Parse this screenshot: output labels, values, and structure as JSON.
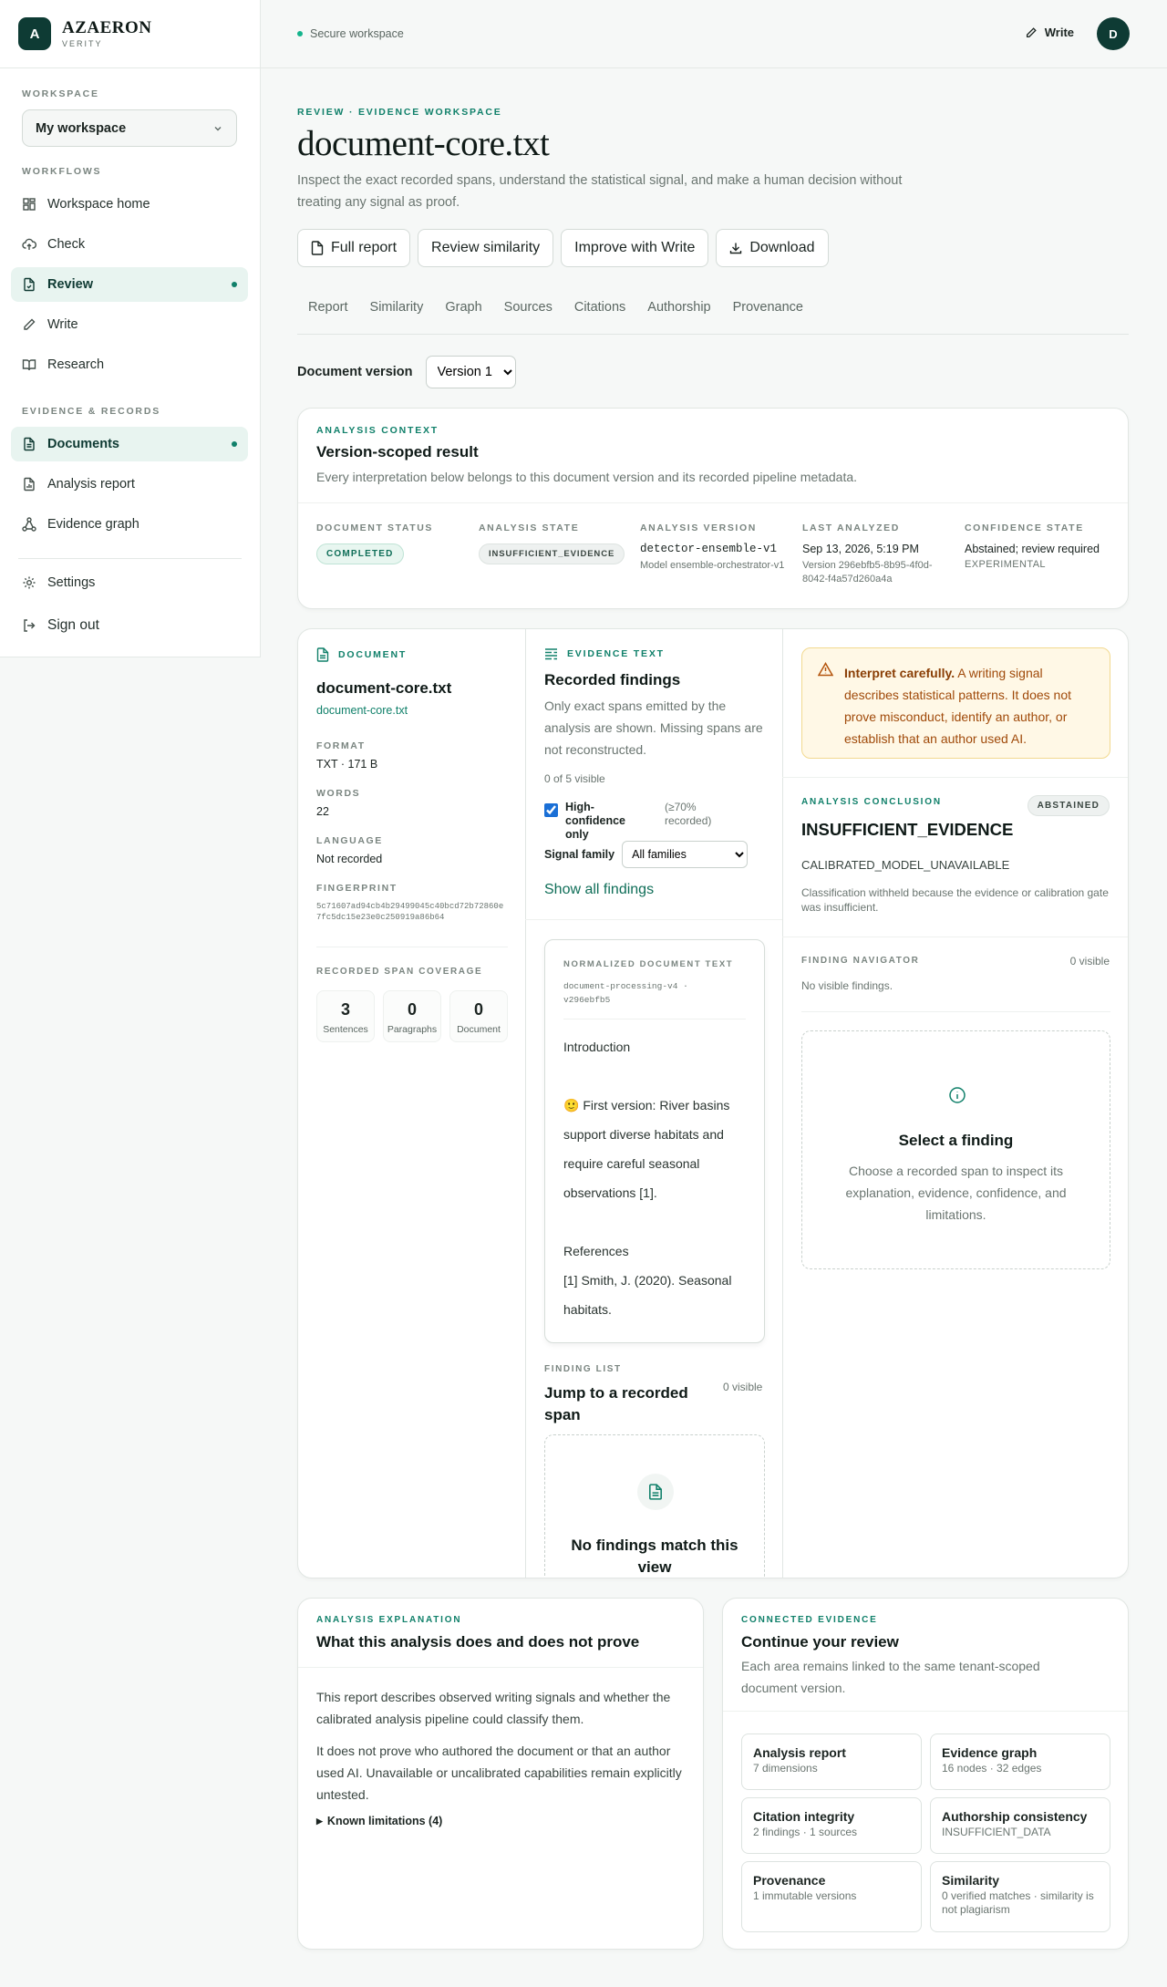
{
  "brand": {
    "logo": "A",
    "name": "AZAERON",
    "sub": "VERITY"
  },
  "sidebar": {
    "workspace_label": "WORKSPACE",
    "workspace_value": "My workspace",
    "workflows_label": "WORKFLOWS",
    "workflows": [
      {
        "label": "Workspace home",
        "icon": "grid-icon"
      },
      {
        "label": "Check",
        "icon": "cloud-upload-icon"
      },
      {
        "label": "Review",
        "icon": "file-check-icon",
        "active": true
      },
      {
        "label": "Write",
        "icon": "pencil-icon"
      },
      {
        "label": "Research",
        "icon": "book-icon"
      }
    ],
    "evidence_label": "EVIDENCE & RECORDS",
    "evidence": [
      {
        "label": "Documents",
        "icon": "file-icon",
        "active": true
      },
      {
        "label": "Analysis report",
        "icon": "file-chart-icon"
      },
      {
        "label": "Evidence graph",
        "icon": "network-icon"
      }
    ],
    "settings": "Settings",
    "signout": "Sign out"
  },
  "topbar": {
    "secure": "Secure workspace",
    "write": "Write",
    "avatar": "D"
  },
  "page": {
    "kicker": "REVIEW · EVIDENCE WORKSPACE",
    "title": "document-core.txt",
    "lede": "Inspect the exact recorded spans, understand the statistical signal, and make a human decision without treating any signal as proof.",
    "actions": [
      "Full report",
      "Review similarity",
      "Improve with Write",
      "Download"
    ],
    "tabs": [
      "Report",
      "Similarity",
      "Graph",
      "Sources",
      "Citations",
      "Authorship",
      "Provenance"
    ],
    "docver_label": "Document version",
    "docver_value": "Version 1"
  },
  "context": {
    "kicker": "ANALYSIS CONTEXT",
    "title": "Version-scoped result",
    "desc": "Every interpretation below belongs to this document version and its recorded pipeline metadata.",
    "status_label": "DOCUMENT STATUS",
    "status": "COMPLETED",
    "state_label": "ANALYSIS STATE",
    "state": "INSUFFICIENT_EVIDENCE",
    "version_label": "ANALYSIS VERSION",
    "version": "detector-ensemble-v1",
    "version_sub": "Model ensemble-orchestrator-v1",
    "last_label": "LAST ANALYZED",
    "last": "Sep 13, 2026, 5:19 PM",
    "last_sub": "Version 296ebfb5-8b95-4f0d-8042-f4a57d260a4a",
    "conf_label": "CONFIDENCE STATE",
    "conf": "Abstained; review required",
    "conf_sub": "EXPERIMENTAL"
  },
  "document": {
    "kicker": "DOCUMENT",
    "name": "document-core.txt",
    "file": "document-core.txt",
    "format_label": "FORMAT",
    "format": "TXT · 171 B",
    "words_label": "WORDS",
    "words": "22",
    "lang_label": "LANGUAGE",
    "lang": "Not recorded",
    "fp_label": "FINGERPRINT",
    "fp": "5c71607ad94cb4b29499045c40bcd72b72860e7fc5dc15e23e0c250919a86b64",
    "coverage_label": "RECORDED SPAN COVERAGE",
    "coverage": [
      {
        "n": "3",
        "l": "Sentences"
      },
      {
        "n": "0",
        "l": "Paragraphs"
      },
      {
        "n": "0",
        "l": "Document"
      }
    ]
  },
  "evidence": {
    "kicker": "EVIDENCE TEXT",
    "title": "Recorded findings",
    "desc": "Only exact spans emitted by the analysis are shown. Missing spans are not reconstructed.",
    "count": "0 of 5 visible",
    "hc_label": "High-confidence only",
    "hc_note": "(≥70% recorded)",
    "family_label": "Signal family",
    "family_value": "All families",
    "show_all": "Show all findings",
    "norm_label": "NORMALIZED DOCUMENT TEXT",
    "norm_meta": "document-processing-v4 · v296ebfb5",
    "lines": [
      "Introduction",
      "",
      "🙂 First version: River basins support diverse habitats and require careful seasonal observations [1].",
      "",
      "References",
      "[1] Smith, J. (2020). Seasonal habitats."
    ],
    "list_label": "FINDING LIST",
    "list_title": "Jump to a recorded span",
    "list_count": "0 visible",
    "empty": "No findings match this view"
  },
  "right": {
    "warn_strong": "Interpret carefully.",
    "warn": "A writing signal describes statistical patterns. It does not prove misconduct, identify an author, or establish that an author used AI.",
    "concl_label": "ANALYSIS CONCLUSION",
    "badge": "ABSTAINED",
    "concl": "INSUFFICIENT_EVIDENCE",
    "reason": "CALIBRATED_MODEL_UNAVAILABLE",
    "reason_desc": "Classification withheld because the evidence or calibration gate was insufficient.",
    "nav_label": "FINDING NAVIGATOR",
    "nav_count": "0 visible",
    "nav_empty": "No visible findings.",
    "select_title": "Select a finding",
    "select_desc": "Choose a recorded span to inspect its explanation, evidence, confidence, and limitations."
  },
  "explain": {
    "kicker": "ANALYSIS EXPLANATION",
    "title": "What this analysis does and does not prove",
    "p1": "This report describes observed writing signals and whether the calibrated analysis pipeline could classify them.",
    "p2": "It does not prove who authored the document or that an author used AI. Unavailable or uncalibrated capabilities remain explicitly untested.",
    "limits": "Known limitations (4)"
  },
  "connected": {
    "kicker": "CONNECTED EVIDENCE",
    "title": "Continue your review",
    "desc": "Each area remains linked to the same tenant-scoped document version.",
    "items": [
      {
        "t": "Analysis report",
        "s": "7 dimensions"
      },
      {
        "t": "Evidence graph",
        "s": "16 nodes · 32 edges"
      },
      {
        "t": "Citation integrity",
        "s": "2 findings · 1 sources"
      },
      {
        "t": "Authorship consistency",
        "s": "INSUFFICIENT_DATA"
      },
      {
        "t": "Provenance",
        "s": "1 immutable versions"
      },
      {
        "t": "Similarity",
        "s": "0 verified matches · similarity is not plagiarism"
      }
    ]
  }
}
